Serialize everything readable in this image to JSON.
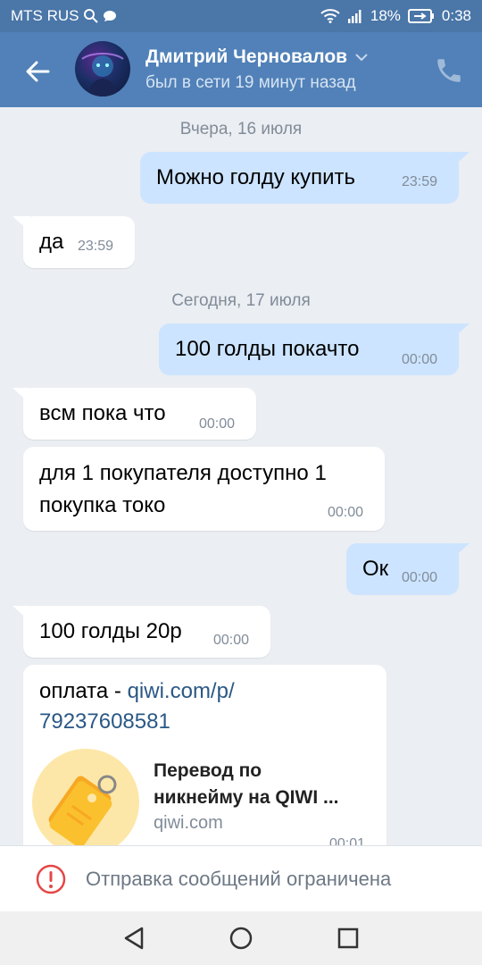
{
  "status_bar": {
    "carrier": "MTS RUS",
    "battery": "18%",
    "time": "0:38"
  },
  "header": {
    "contact_name": "Дмитрий Черновалов",
    "last_seen": "был в сети 19 минут назад"
  },
  "chat": {
    "date_yesterday": "Вчера, 16 июля",
    "date_today": "Сегодня, 17 июля",
    "messages": [
      {
        "dir": "out",
        "text": "Можно голду купить",
        "time": "23:59"
      },
      {
        "dir": "in",
        "text": "да",
        "time": "23:59"
      },
      {
        "dir": "out",
        "text": "100 голды покачто",
        "time": "00:00"
      },
      {
        "dir": "in",
        "text": "всм пока что",
        "time": "00:00"
      },
      {
        "dir": "in",
        "line1": "для 1 покупателя доступно 1",
        "line2": "покупка токо",
        "time": "00:00"
      },
      {
        "dir": "out",
        "text": "Ок",
        "time": "00:00"
      },
      {
        "dir": "in",
        "text": "100 голды 20р",
        "time": "00:00"
      },
      {
        "dir": "in",
        "prefix": "оплата - ",
        "link_line1": "qiwi.com/p/",
        "link_line2": "79237608581",
        "time": "00:01"
      }
    ],
    "link_preview": {
      "title_line1": "Перевод по",
      "title_line2": "никнейму на QIWI ...",
      "domain": "qiwi.com"
    }
  },
  "restricted_bar": {
    "text": "Отправка сообщений ограничена"
  },
  "icons": {
    "back": "arrow-left-icon",
    "call": "phone-icon",
    "alert": "exclamation-circle-icon",
    "nav_back": "triangle-back-icon",
    "nav_home": "circle-home-icon",
    "nav_recent": "square-recent-icon"
  },
  "colors": {
    "header_bg": "#5181b8",
    "outgoing_bubble": "#cce4ff",
    "incoming_bubble": "#ffffff",
    "link": "#2a5885",
    "alert": "#e64646"
  }
}
